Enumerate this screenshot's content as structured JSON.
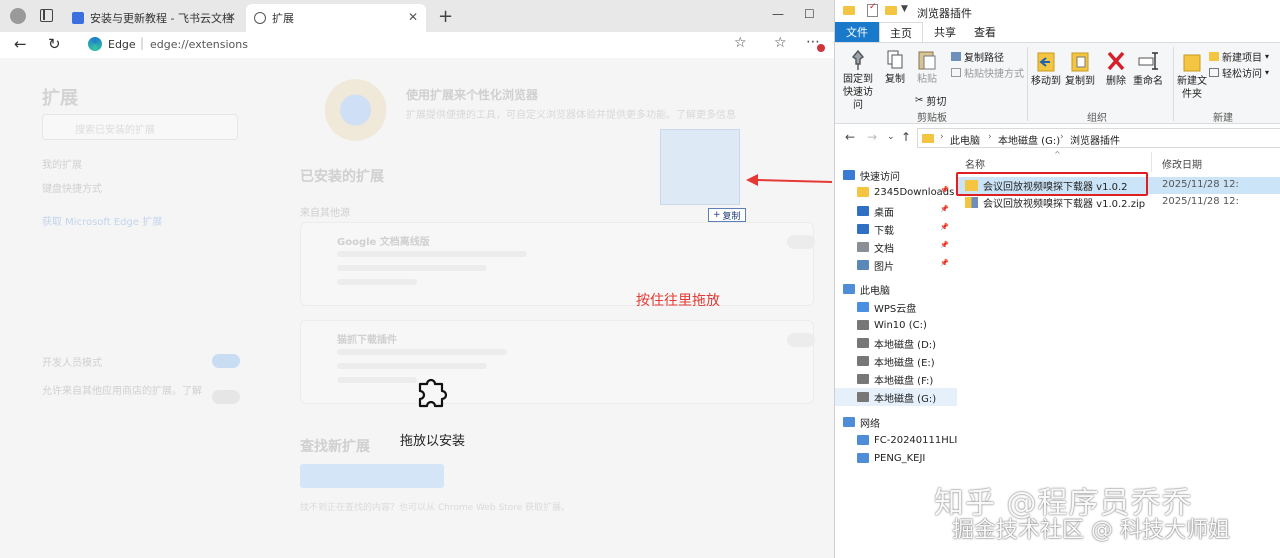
{
  "browser": {
    "tabs": [
      {
        "title": "安装与更新教程 - 飞书云文档",
        "close": "✕"
      },
      {
        "title": "扩展",
        "close": "✕"
      }
    ],
    "new_tab": "+",
    "window_controls": {
      "minimize": "—",
      "maximize": "☐"
    },
    "address": {
      "site_label": "Edge",
      "separator": "|",
      "url": "edge://extensions"
    },
    "page": {
      "sidebar_title": "扩展",
      "search_placeholder": "搜索已安装的扩展",
      "side_items": [
        "我的扩展",
        "键盘快捷方式"
      ],
      "side_link": "获取 Microsoft Edge 扩展",
      "dev_mode": "开发人员模式",
      "dev_desc": "允许来自其他应用商店的扩展。了解",
      "hero_title": "使用扩展来个性化浏览器",
      "hero_desc": "扩展提供便捷的工具，可自定义浏览器体验并提供更多功能。了解更多信息",
      "installed_title": "已安装的扩展",
      "from_other": "来自其他源",
      "ext1_name": "Google 文档离线版",
      "ext2_name": "猫抓下载插件",
      "find_title": "查找新扩展",
      "find_button": "获取 Microsoft Edge 扩展",
      "find_desc": "找不到正在查找的内容？也可以从 Chrome Web Store 获取扩展。",
      "drop_text": "拖放以安装"
    },
    "drag": {
      "copy_label": "复制",
      "copy_plus": "+"
    },
    "annotation": "按住往里拖放"
  },
  "explorer": {
    "title": "浏览器插件",
    "ribbon_tabs": [
      "文件",
      "主页",
      "共享",
      "查看"
    ],
    "ribbon": {
      "pin_quick": "固定到快速访问",
      "copy": "复制",
      "paste": "粘贴",
      "copy_path": "复制路径",
      "paste_shortcut": "粘贴快捷方式",
      "cut": "剪切",
      "clipboard_group": "剪贴板",
      "move_to": "移动到",
      "copy_to": "复制到",
      "delete": "删除",
      "rename": "重命名",
      "organize_group": "组织",
      "new_folder": "新建文件夹",
      "new_item": "新建项目",
      "easy_access": "轻松访问",
      "new_group": "新建"
    },
    "breadcrumb": [
      "此电脑",
      "本地磁盘 (G:)",
      "浏览器插件"
    ],
    "nav": [
      {
        "label": "快速访问",
        "icon": "star-icon"
      },
      {
        "label": "2345Downloads",
        "icon": "folder-icon",
        "pin": true
      },
      {
        "label": "桌面",
        "icon": "desktop-icon",
        "pin": true
      },
      {
        "label": "下载",
        "icon": "download-icon",
        "pin": true
      },
      {
        "label": "文档",
        "icon": "document-icon",
        "pin": true
      },
      {
        "label": "图片",
        "icon": "picture-icon",
        "pin": true
      },
      {
        "label": "此电脑",
        "icon": "pc-icon"
      },
      {
        "label": "WPS云盘",
        "icon": "cloud-icon"
      },
      {
        "label": "Win10 (C:)",
        "icon": "drive-icon"
      },
      {
        "label": "本地磁盘 (D:)",
        "icon": "drive-icon"
      },
      {
        "label": "本地磁盘 (E:)",
        "icon": "drive-icon"
      },
      {
        "label": "本地磁盘 (F:)",
        "icon": "drive-icon"
      },
      {
        "label": "本地磁盘 (G:)",
        "icon": "drive-icon",
        "selected": true
      },
      {
        "label": "网络",
        "icon": "network-icon"
      },
      {
        "label": "FC-20240111HLII",
        "icon": "computer-icon"
      },
      {
        "label": "PENG_KEJI",
        "icon": "computer-icon"
      }
    ],
    "columns": {
      "name": "名称",
      "modified": "修改日期"
    },
    "files": [
      {
        "name": "会议回放视频嗅探下载器 v1.0.2",
        "date": "2025/11/28 12:",
        "type": "folder"
      },
      {
        "name": "会议回放视频嗅探下载器 v1.0.2.zip",
        "date": "2025/11/28 12:",
        "type": "zip"
      }
    ]
  },
  "watermark": {
    "line1": "知乎 @程序员乔乔",
    "line2": "掘金技术社区 @ 科技大师姐"
  },
  "colors": {
    "annotation_red": "#e53935",
    "file_tab_blue": "#1979ca",
    "folder_yellow": "#f4c542"
  }
}
